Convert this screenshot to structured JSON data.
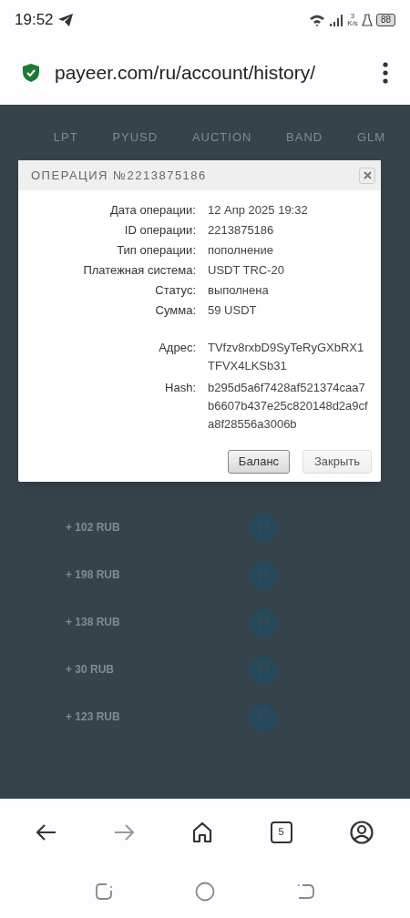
{
  "status_bar": {
    "time": "19:52",
    "speed_value": "3",
    "speed_unit": "K/s",
    "battery": "88"
  },
  "address_bar": {
    "url": "payeer.com/ru/account/history/"
  },
  "background": {
    "currencies": [
      "LPT",
      "PYUSD",
      "AUCTION",
      "BAND",
      "GLM"
    ],
    "amounts": [
      "+ 102 RUB",
      "+ 198 RUB",
      "+ 138 RUB",
      "+ 30 RUB",
      "+ 123 RUB"
    ]
  },
  "dialog": {
    "title": "ОПЕРАЦИЯ №2213875186",
    "fields": [
      {
        "label": "Дата операции:",
        "value": "12 Апр 2025 19:32"
      },
      {
        "label": "ID операции:",
        "value": "2213875186"
      },
      {
        "label": "Тип операции:",
        "value": "пополнение"
      },
      {
        "label": "Платежная система:",
        "value": "USDT TRC-20"
      },
      {
        "label": "Статус:",
        "value": "выполнена"
      },
      {
        "label": "Сумма:",
        "value": "59 USDT"
      }
    ],
    "details": [
      {
        "label": "Адрес:",
        "value": "TVfzv8rxbD9SyTeRyGXbRX1TFVX4LKSb31"
      },
      {
        "label": "Hash:",
        "value": "b295d5a6f7428af521374caa7b6607b437e25c820148d2a9cfa8f28556a3006b"
      }
    ],
    "buttons": [
      {
        "label": "Баланс",
        "selected": true
      },
      {
        "label": "Закрыть",
        "selected": false
      }
    ]
  },
  "bottom_nav": {
    "tab_count": "5",
    "forward_disabled": true
  }
}
